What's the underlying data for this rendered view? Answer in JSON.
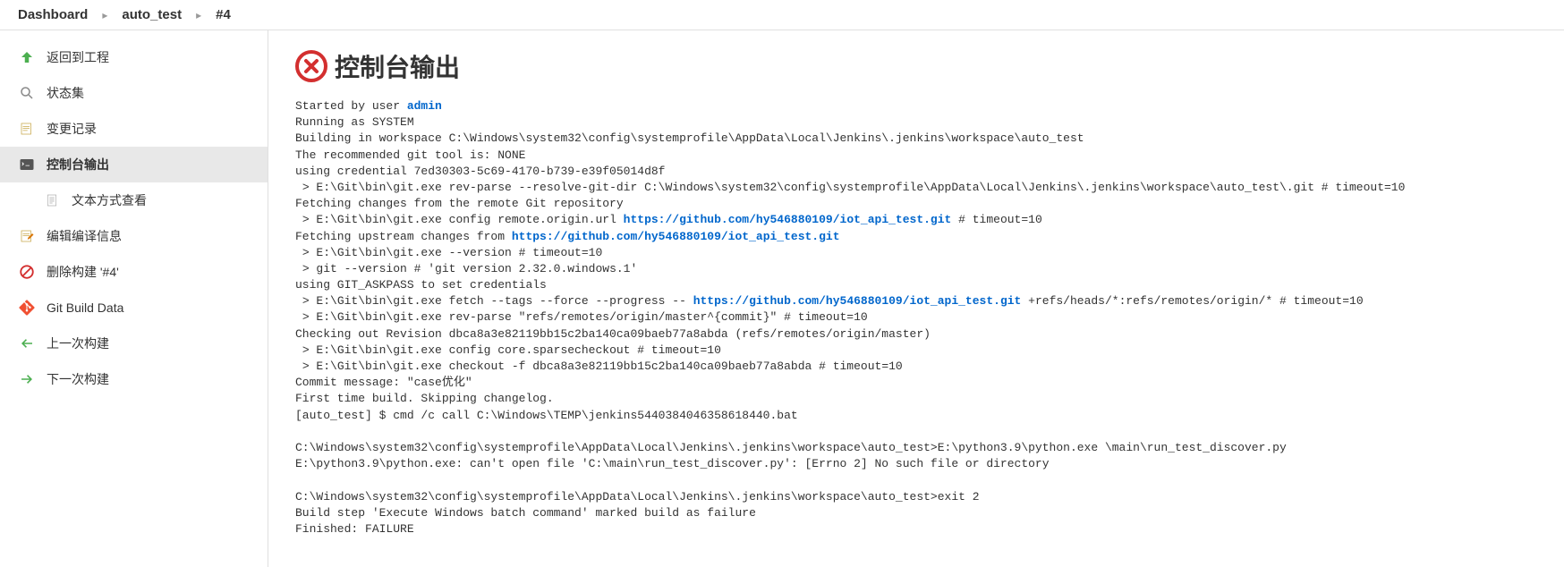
{
  "breadcrumb": {
    "dashboard": "Dashboard",
    "project": "auto_test",
    "build": "#4"
  },
  "sidebar": {
    "items": [
      {
        "label": "返回到工程"
      },
      {
        "label": "状态集"
      },
      {
        "label": "变更记录"
      },
      {
        "label": "控制台输出"
      },
      {
        "label": "文本方式查看"
      },
      {
        "label": "编辑编译信息"
      },
      {
        "label": "删除构建 '#4'"
      },
      {
        "label": "Git Build Data"
      },
      {
        "label": "上一次构建"
      },
      {
        "label": "下一次构建"
      }
    ]
  },
  "page": {
    "title": "控制台输出"
  },
  "console": {
    "l1a": "Started by user ",
    "l1b": "admin",
    "l2": "Running as SYSTEM",
    "l3": "Building in workspace C:\\Windows\\system32\\config\\systemprofile\\AppData\\Local\\Jenkins\\.jenkins\\workspace\\auto_test",
    "l4": "The recommended git tool is: NONE",
    "l5": "using credential 7ed30303-5c69-4170-b739-e39f05014d8f",
    "l6": " > E:\\Git\\bin\\git.exe rev-parse --resolve-git-dir C:\\Windows\\system32\\config\\systemprofile\\AppData\\Local\\Jenkins\\.jenkins\\workspace\\auto_test\\.git # timeout=10",
    "l7": "Fetching changes from the remote Git repository",
    "l8a": " > E:\\Git\\bin\\git.exe config remote.origin.url ",
    "l8b": "https://github.com/hy546880109/iot_api_test.git",
    "l8c": " # timeout=10",
    "l9a": "Fetching upstream changes from ",
    "l9b": "https://github.com/hy546880109/iot_api_test.git",
    "l10": " > E:\\Git\\bin\\git.exe --version # timeout=10",
    "l11": " > git --version # 'git version 2.32.0.windows.1'",
    "l12": "using GIT_ASKPASS to set credentials ",
    "l13a": " > E:\\Git\\bin\\git.exe fetch --tags --force --progress -- ",
    "l13b": "https://github.com/hy546880109/iot_api_test.git",
    "l13c": " +refs/heads/*:refs/remotes/origin/* # timeout=10",
    "l14": " > E:\\Git\\bin\\git.exe rev-parse \"refs/remotes/origin/master^{commit}\" # timeout=10",
    "l15": "Checking out Revision dbca8a3e82119bb15c2ba140ca09baeb77a8abda (refs/remotes/origin/master)",
    "l16": " > E:\\Git\\bin\\git.exe config core.sparsecheckout # timeout=10",
    "l17": " > E:\\Git\\bin\\git.exe checkout -f dbca8a3e82119bb15c2ba140ca09baeb77a8abda # timeout=10",
    "l18": "Commit message: \"case优化\"",
    "l19": "First time build. Skipping changelog.",
    "l20": "[auto_test] $ cmd /c call C:\\Windows\\TEMP\\jenkins5440384046358618440.bat",
    "l21": "",
    "l22": "C:\\Windows\\system32\\config\\systemprofile\\AppData\\Local\\Jenkins\\.jenkins\\workspace\\auto_test>E:\\python3.9\\python.exe \\main\\run_test_discover.py ",
    "l23": "E:\\python3.9\\python.exe: can't open file 'C:\\main\\run_test_discover.py': [Errno 2] No such file or directory",
    "l24": "",
    "l25": "C:\\Windows\\system32\\config\\systemprofile\\AppData\\Local\\Jenkins\\.jenkins\\workspace\\auto_test>exit 2 ",
    "l26": "Build step 'Execute Windows batch command' marked build as failure",
    "l27": "Finished: FAILURE"
  }
}
